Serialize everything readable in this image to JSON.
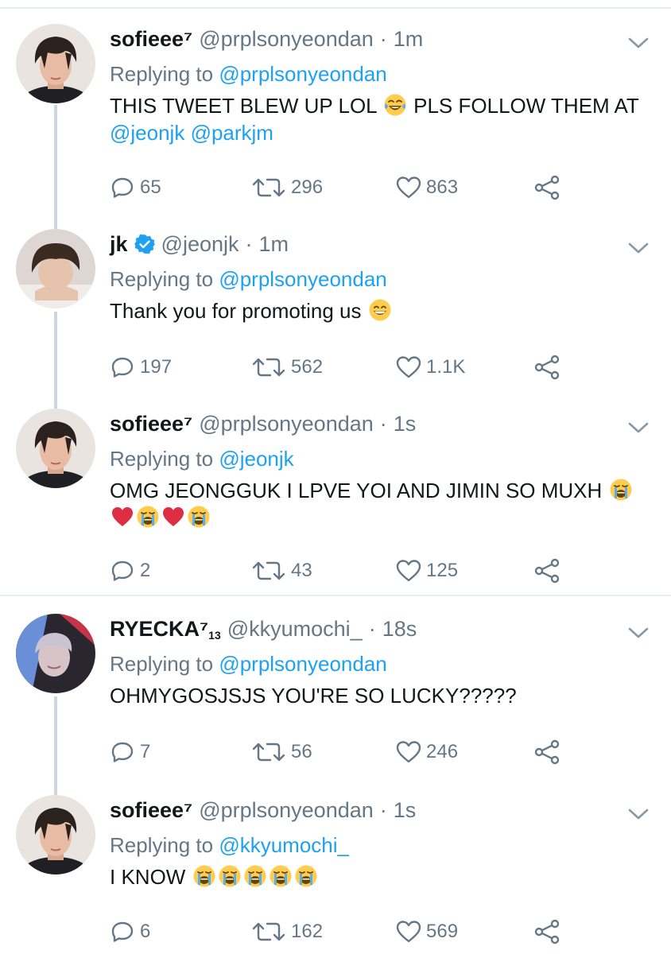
{
  "colors": {
    "link": "#1da1f2",
    "muted": "#657786",
    "text": "#14171a",
    "divider": "#e6ecf0",
    "thread": "#ccd6dd"
  },
  "tweets": [
    {
      "name": "sofieee⁷",
      "name_sub": "",
      "handle": "@prplsonyeondan",
      "time": "1m",
      "replying_label": "Replying to",
      "replying_to": "@prplsonyeondan",
      "text_1": "THIS TWEET BLEW UP LOL ",
      "emoji_1": "face-with-tears-of-joy",
      "text_2": " PLS FOLLOW THEM AT",
      "mention_1": "@jeonjk",
      "mention_2": "@parkjm",
      "replies": "65",
      "retweets": "296",
      "likes": "863"
    },
    {
      "name": "jk",
      "verified": true,
      "handle": "@jeonjk",
      "time": "1m",
      "replying_label": "Replying to",
      "replying_to": "@prplsonyeondan",
      "text_1": "Thank you for promoting us ",
      "emoji_1": "grinning-face-with-smiling-eyes",
      "replies": "197",
      "retweets": "562",
      "likes": "1.1K"
    },
    {
      "name": "sofieee⁷",
      "handle": "@prplsonyeondan",
      "time": "1s",
      "replying_label": "Replying to",
      "replying_to": "@jeonjk",
      "text_1": "OMG JEONGGUK I LPVE YOI AND JIMIN SO MUXH ",
      "emojis": [
        "loudly-crying-face",
        "red-heart",
        "loudly-crying-face",
        "red-heart",
        "loudly-crying-face"
      ],
      "replies": "2",
      "retweets": "43",
      "likes": "125"
    },
    {
      "name": "RYECKA⁷",
      "name_sub": "13",
      "handle": "@kkyumochi_",
      "time": "18s",
      "replying_label": "Replying to",
      "replying_to": "@prplsonyeondan",
      "text_1": "OHMYGOSJSJS YOU'RE SO LUCKY?????",
      "replies": "7",
      "retweets": "56",
      "likes": "246"
    },
    {
      "name": "sofieee⁷",
      "handle": "@prplsonyeondan",
      "time": "1s",
      "replying_label": "Replying to",
      "replying_to": "@kkyumochi_",
      "text_1": "I KNOW ",
      "emojis": [
        "loudly-crying-face",
        "loudly-crying-face",
        "loudly-crying-face",
        "loudly-crying-face",
        "loudly-crying-face"
      ],
      "replies": "6",
      "retweets": "162",
      "likes": "569"
    }
  ],
  "dot": "·"
}
